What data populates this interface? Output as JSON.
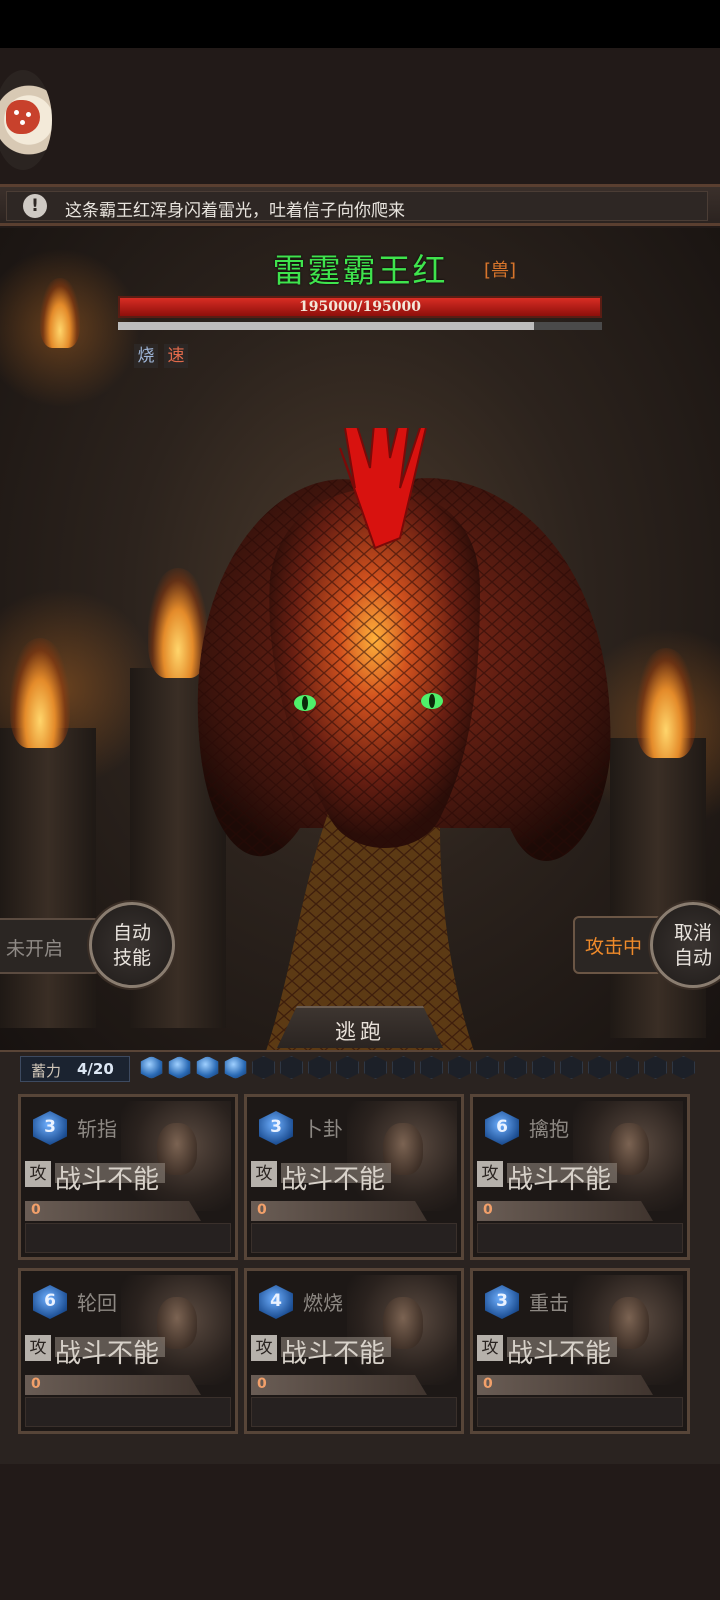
{
  "notice": {
    "text": "这条霸王红浑身闪着雷光，吐着信子向你爬来",
    "icon": "alert-icon"
  },
  "boss": {
    "name": "雷霆霸王红",
    "tag": "[兽]",
    "hp_text": "195000/195000",
    "hp_fraction": 1.0,
    "secondary_fraction": 0.86,
    "status_effects": [
      {
        "label": "烧"
      },
      {
        "label": "速"
      }
    ]
  },
  "controls": {
    "left_status": "未开启",
    "auto_skill": "自动\n技能",
    "attacking": "攻击中",
    "cancel_auto": "取消\n自动",
    "flee": "逃跑"
  },
  "charge": {
    "label": "蓄力",
    "value": "4/20",
    "filled": 4,
    "total": 20
  },
  "cards": [
    {
      "level": "3",
      "skill": "斩指",
      "atk_label": "攻",
      "state": "战斗不能",
      "value": "0"
    },
    {
      "level": "3",
      "skill": "卜卦",
      "atk_label": "攻",
      "state": "战斗不能",
      "value": "0"
    },
    {
      "level": "6",
      "skill": "擒抱",
      "atk_label": "攻",
      "state": "战斗不能",
      "value": "0"
    },
    {
      "level": "6",
      "skill": "轮回",
      "atk_label": "攻",
      "state": "战斗不能",
      "value": "0"
    },
    {
      "level": "4",
      "skill": "燃烧",
      "atk_label": "攻",
      "state": "战斗不能",
      "value": "0"
    },
    {
      "level": "3",
      "skill": "重击",
      "atk_label": "攻",
      "state": "战斗不能",
      "value": "0"
    }
  ],
  "colors": {
    "boss_name": "#3fe34d",
    "hp": "#d82d24",
    "attacking": "#ef8a2a"
  }
}
